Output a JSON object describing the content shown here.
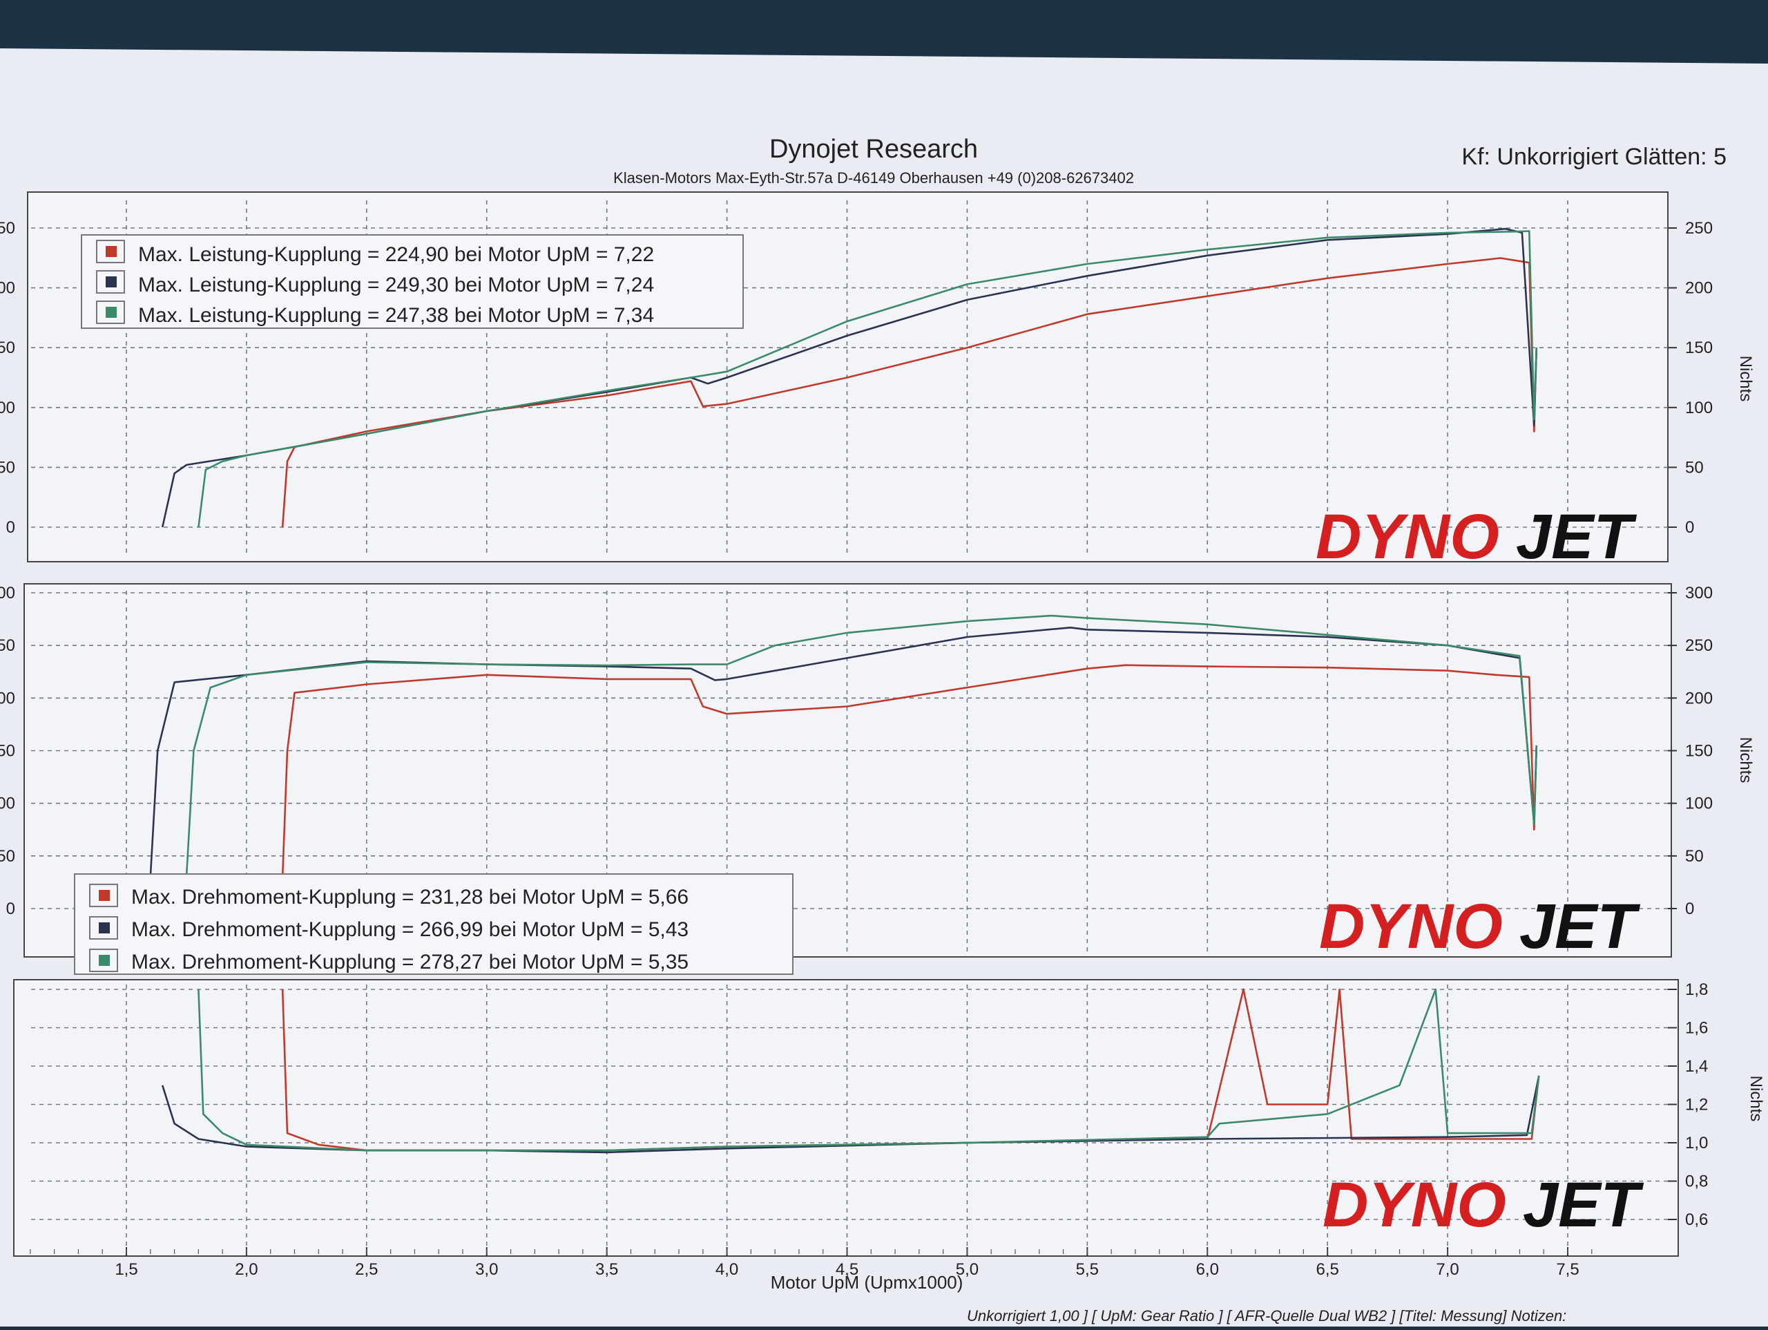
{
  "header": {
    "title": "Dynojet Research",
    "subtitle": "Klasen-Motors   Max-Eyth-Str.57a   D-46149 Oberhausen   +49 (0)208-62673402",
    "correction": "Kf: Unkorrigiert Glätten: 5"
  },
  "logo": {
    "text_a": "DYNO",
    "text_b": "JET"
  },
  "footer": {
    "xlabel": "Motor UpM (Upmx1000)",
    "info": "Unkorrigiert 1,00 ] [ UpM: Gear Ratio ] [ AFR-Quelle  Dual WB2 ] [Titel: Messung]  Notizen:"
  },
  "colors": {
    "red": "#c0392b",
    "blue": "#2a3350",
    "green": "#3b8a6a",
    "logo_red": "#d42020",
    "logo_black": "#111111"
  },
  "chart_data": [
    {
      "type": "line",
      "name": "power",
      "ylabel": "Nichts",
      "xlim": [
        1.0,
        7.5
      ],
      "ylim": [
        0,
        250
      ],
      "y_ticks_right": [
        0,
        50,
        100,
        150,
        200,
        250
      ],
      "y_ticks_left": [
        "0",
        "50",
        "00",
        "50",
        "00",
        "50"
      ],
      "grid": true,
      "legend_position": "top-left",
      "series": [
        {
          "name": "Max. Leistung-Kupplung = 224,90 bei Motor UpM = 7,22",
          "color": "red",
          "x": [
            2.15,
            2.17,
            2.2,
            2.5,
            3.0,
            3.5,
            3.85,
            3.9,
            4.0,
            4.5,
            5.0,
            5.5,
            6.0,
            6.5,
            7.0,
            7.22,
            7.34,
            7.36,
            7.37
          ],
          "y": [
            0,
            55,
            67,
            80,
            97,
            110,
            122,
            101,
            103,
            125,
            150,
            178,
            193,
            208,
            220,
            224.9,
            221,
            80,
            150
          ]
        },
        {
          "name": "Max. Leistung-Kupplung = 249,30 bei Motor UpM = 7,24",
          "color": "blue",
          "x": [
            1.65,
            1.7,
            1.75,
            2.0,
            2.5,
            3.0,
            3.5,
            3.85,
            3.92,
            4.0,
            4.5,
            5.0,
            5.5,
            6.0,
            6.5,
            7.0,
            7.24,
            7.31,
            7.36,
            7.37
          ],
          "y": [
            0,
            45,
            52,
            60,
            78,
            97,
            113,
            125,
            120,
            125,
            160,
            190,
            210,
            227,
            240,
            245,
            249.3,
            246,
            85,
            150
          ]
        },
        {
          "name": "Max. Leistung-Kupplung = 247,38 bei Motor UpM = 7,34",
          "color": "green",
          "x": [
            1.8,
            1.83,
            1.9,
            2.0,
            2.5,
            3.0,
            3.5,
            3.85,
            4.0,
            4.5,
            5.0,
            5.5,
            6.0,
            6.5,
            7.0,
            7.28,
            7.34,
            7.36,
            7.37
          ],
          "y": [
            0,
            48,
            55,
            60,
            78,
            97,
            114,
            125,
            130,
            172,
            203,
            220,
            232,
            242,
            246,
            247,
            247.38,
            90,
            150
          ]
        }
      ]
    },
    {
      "type": "line",
      "name": "torque",
      "ylabel": "Nichts",
      "xlim": [
        1.0,
        7.5
      ],
      "ylim": [
        0,
        300
      ],
      "y_ticks_right": [
        0,
        50,
        100,
        150,
        200,
        250,
        300
      ],
      "y_ticks_left": [
        "0",
        "50",
        "00",
        "50",
        "00",
        "50",
        "00"
      ],
      "grid": true,
      "legend_position": "bottom-left",
      "series": [
        {
          "name": "Max. Drehmoment-Kupplung = 231,28 bei Motor UpM = 5,66",
          "color": "red",
          "x": [
            2.15,
            2.17,
            2.2,
            2.5,
            3.0,
            3.5,
            3.85,
            3.9,
            4.0,
            4.5,
            5.0,
            5.5,
            5.66,
            6.0,
            6.5,
            7.0,
            7.2,
            7.34,
            7.36,
            7.37
          ],
          "y": [
            30,
            150,
            205,
            213,
            222,
            218,
            218,
            192,
            185,
            192,
            210,
            228,
            231.28,
            230,
            229,
            226,
            222,
            220,
            75,
            155
          ]
        },
        {
          "name": "Max. Drehmoment-Kupplung = 266,99 bei Motor UpM = 5,43",
          "color": "blue",
          "x": [
            1.6,
            1.63,
            1.7,
            2.0,
            2.5,
            3.0,
            3.5,
            3.85,
            3.95,
            4.0,
            4.5,
            5.0,
            5.43,
            5.5,
            6.0,
            6.5,
            7.0,
            7.3,
            7.36,
            7.37
          ],
          "y": [
            30,
            150,
            215,
            222,
            235,
            232,
            230,
            228,
            217,
            218,
            238,
            258,
            266.99,
            265,
            262,
            258,
            250,
            238,
            80,
            155
          ]
        },
        {
          "name": "Max. Drehmoment-Kupplung = 278,27 bei Motor UpM = 5,35",
          "color": "green",
          "x": [
            1.75,
            1.78,
            1.85,
            2.0,
            2.5,
            3.0,
            3.5,
            3.85,
            4.0,
            4.2,
            4.5,
            5.0,
            5.35,
            5.5,
            6.0,
            6.5,
            7.0,
            7.3,
            7.36,
            7.37
          ],
          "y": [
            30,
            150,
            210,
            222,
            234,
            232,
            231,
            232,
            232,
            250,
            262,
            273,
            278.27,
            276,
            270,
            260,
            250,
            240,
            80,
            155
          ]
        }
      ]
    },
    {
      "type": "line",
      "name": "afr",
      "ylabel": "Nichts",
      "xlim": [
        1.0,
        7.5
      ],
      "ylim": [
        0.6,
        1.8
      ],
      "y_ticks_right": [
        "0,6",
        "0,8",
        "1,0",
        "1,2",
        "1,4",
        "1,6",
        "1,8"
      ],
      "grid": true,
      "series": [
        {
          "color": "red",
          "x": [
            2.15,
            2.17,
            2.3,
            2.5,
            3.0,
            3.5,
            4.0,
            5.0,
            6.0,
            6.15,
            6.25,
            6.5,
            6.55,
            6.6,
            7.0,
            7.35,
            7.38
          ],
          "y": [
            1.8,
            1.05,
            0.99,
            0.96,
            0.96,
            0.96,
            0.98,
            1.0,
            1.02,
            1.8,
            1.2,
            1.2,
            1.8,
            1.02,
            1.02,
            1.02,
            1.35
          ]
        },
        {
          "color": "blue",
          "x": [
            1.65,
            1.7,
            1.8,
            2.0,
            2.5,
            3.0,
            3.5,
            4.0,
            5.0,
            6.0,
            7.0,
            7.33,
            7.38
          ],
          "y": [
            1.3,
            1.1,
            1.02,
            0.98,
            0.96,
            0.96,
            0.95,
            0.97,
            1.0,
            1.02,
            1.03,
            1.04,
            1.35
          ]
        },
        {
          "color": "green",
          "x": [
            1.8,
            1.82,
            1.9,
            2.0,
            2.5,
            3.0,
            3.5,
            4.0,
            5.0,
            6.0,
            6.05,
            6.5,
            6.8,
            6.95,
            7.0,
            7.35,
            7.38
          ],
          "y": [
            1.8,
            1.15,
            1.05,
            0.99,
            0.96,
            0.96,
            0.96,
            0.98,
            1.0,
            1.03,
            1.1,
            1.15,
            1.3,
            1.8,
            1.05,
            1.05,
            1.35
          ]
        }
      ]
    }
  ],
  "x_ticks": [
    "1,5",
    "2,0",
    "2,5",
    "3,0",
    "3,5",
    "4,0",
    "4,5",
    "5,0",
    "5,5",
    "6,0",
    "6,5",
    "7,0",
    "7,5"
  ],
  "x_tick_values": [
    1.5,
    2.0,
    2.5,
    3.0,
    3.5,
    4.0,
    4.5,
    5.0,
    5.5,
    6.0,
    6.5,
    7.0,
    7.5
  ]
}
